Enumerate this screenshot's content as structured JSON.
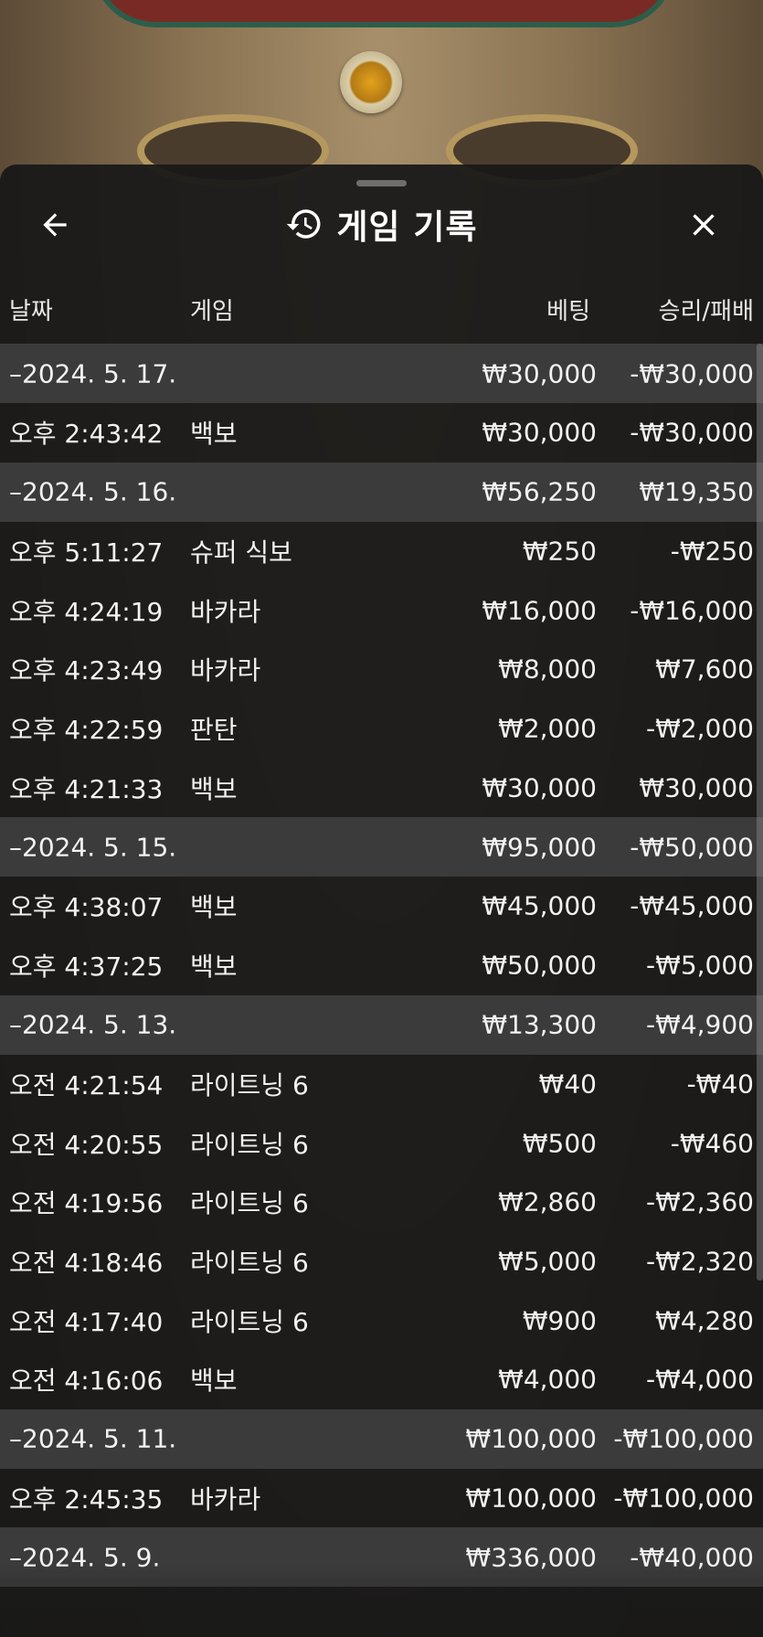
{
  "header": {
    "title": "게임 기록",
    "back_icon": "arrow-left-icon",
    "close_icon": "close-icon",
    "title_icon": "history-icon"
  },
  "columns": {
    "date": "날짜",
    "game": "게임",
    "bet": "베팅",
    "result": "승리/패배"
  },
  "groups": [
    {
      "date": "–2024. 5. 17.",
      "bet": "₩30,000",
      "result": "-₩30,000",
      "rows": [
        {
          "time": "오후 2:43:42",
          "game": "백보",
          "bet": "₩30,000",
          "result": "-₩30,000"
        }
      ]
    },
    {
      "date": "–2024. 5. 16.",
      "bet": "₩56,250",
      "result": "₩19,350",
      "rows": [
        {
          "time": "오후 5:11:27",
          "game": "슈퍼 식보",
          "bet": "₩250",
          "result": "-₩250"
        },
        {
          "time": "오후 4:24:19",
          "game": "바카라",
          "bet": "₩16,000",
          "result": "-₩16,000"
        },
        {
          "time": "오후 4:23:49",
          "game": "바카라",
          "bet": "₩8,000",
          "result": "₩7,600"
        },
        {
          "time": "오후 4:22:59",
          "game": "판탄",
          "bet": "₩2,000",
          "result": "-₩2,000"
        },
        {
          "time": "오후 4:21:33",
          "game": "백보",
          "bet": "₩30,000",
          "result": "₩30,000"
        }
      ]
    },
    {
      "date": "–2024. 5. 15.",
      "bet": "₩95,000",
      "result": "-₩50,000",
      "rows": [
        {
          "time": "오후 4:38:07",
          "game": "백보",
          "bet": "₩45,000",
          "result": "-₩45,000"
        },
        {
          "time": "오후 4:37:25",
          "game": "백보",
          "bet": "₩50,000",
          "result": "-₩5,000"
        }
      ]
    },
    {
      "date": "–2024. 5. 13.",
      "bet": "₩13,300",
      "result": "-₩4,900",
      "rows": [
        {
          "time": "오전 4:21:54",
          "game": "라이트닝 6",
          "bet": "₩40",
          "result": "-₩40"
        },
        {
          "time": "오전 4:20:55",
          "game": "라이트닝 6",
          "bet": "₩500",
          "result": "-₩460"
        },
        {
          "time": "오전 4:19:56",
          "game": "라이트닝 6",
          "bet": "₩2,860",
          "result": "-₩2,360"
        },
        {
          "time": "오전 4:18:46",
          "game": "라이트닝 6",
          "bet": "₩5,000",
          "result": "-₩2,320"
        },
        {
          "time": "오전 4:17:40",
          "game": "라이트닝 6",
          "bet": "₩900",
          "result": "₩4,280"
        },
        {
          "time": "오전 4:16:06",
          "game": "백보",
          "bet": "₩4,000",
          "result": "-₩4,000"
        }
      ]
    },
    {
      "date": "–2024. 5. 11.",
      "bet": "₩100,000",
      "result": "-₩100,000",
      "rows": [
        {
          "time": "오후 2:45:35",
          "game": "바카라",
          "bet": "₩100,000",
          "result": "-₩100,000"
        }
      ]
    },
    {
      "date": "–2024. 5. 9.",
      "bet": "₩336,000",
      "result": "-₩40,000",
      "rows": []
    }
  ]
}
